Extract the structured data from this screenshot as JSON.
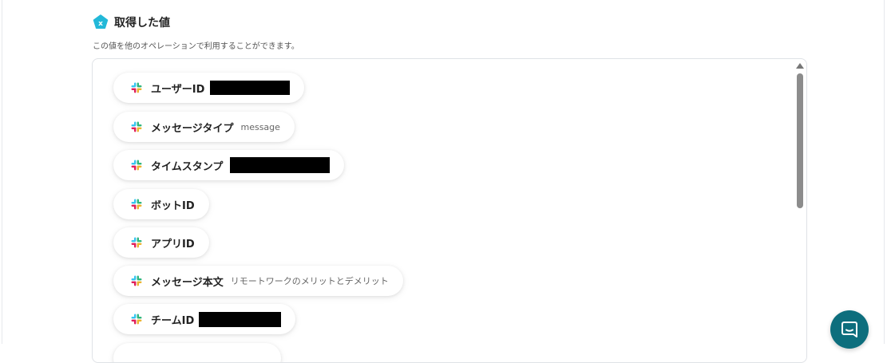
{
  "section": {
    "title": "取得した値",
    "description": "この値を他のオペレーションで利用することができます。",
    "title_icon": "variable-badge-icon"
  },
  "fields": [
    {
      "label": "ユーザーID",
      "value": "",
      "redacted": true,
      "icon": "slack-icon"
    },
    {
      "label": "メッセージタイプ",
      "value": "message",
      "redacted": false,
      "icon": "slack-icon"
    },
    {
      "label": "タイムスタンプ",
      "value": "",
      "redacted": true,
      "icon": "slack-icon"
    },
    {
      "label": "ボットID",
      "value": "",
      "redacted": false,
      "icon": "slack-icon"
    },
    {
      "label": "アプリID",
      "value": "",
      "redacted": false,
      "icon": "slack-icon"
    },
    {
      "label": "メッセージ本文",
      "value": "リモートワークのメリットとデメリット",
      "redacted": false,
      "icon": "slack-icon"
    },
    {
      "label": "チームID",
      "value": "",
      "redacted": true,
      "icon": "slack-icon"
    }
  ],
  "chat_widget": {
    "icon": "chat-icon"
  },
  "colors": {
    "accent": "#22b8d8",
    "chat_button": "#0d6e7d"
  }
}
